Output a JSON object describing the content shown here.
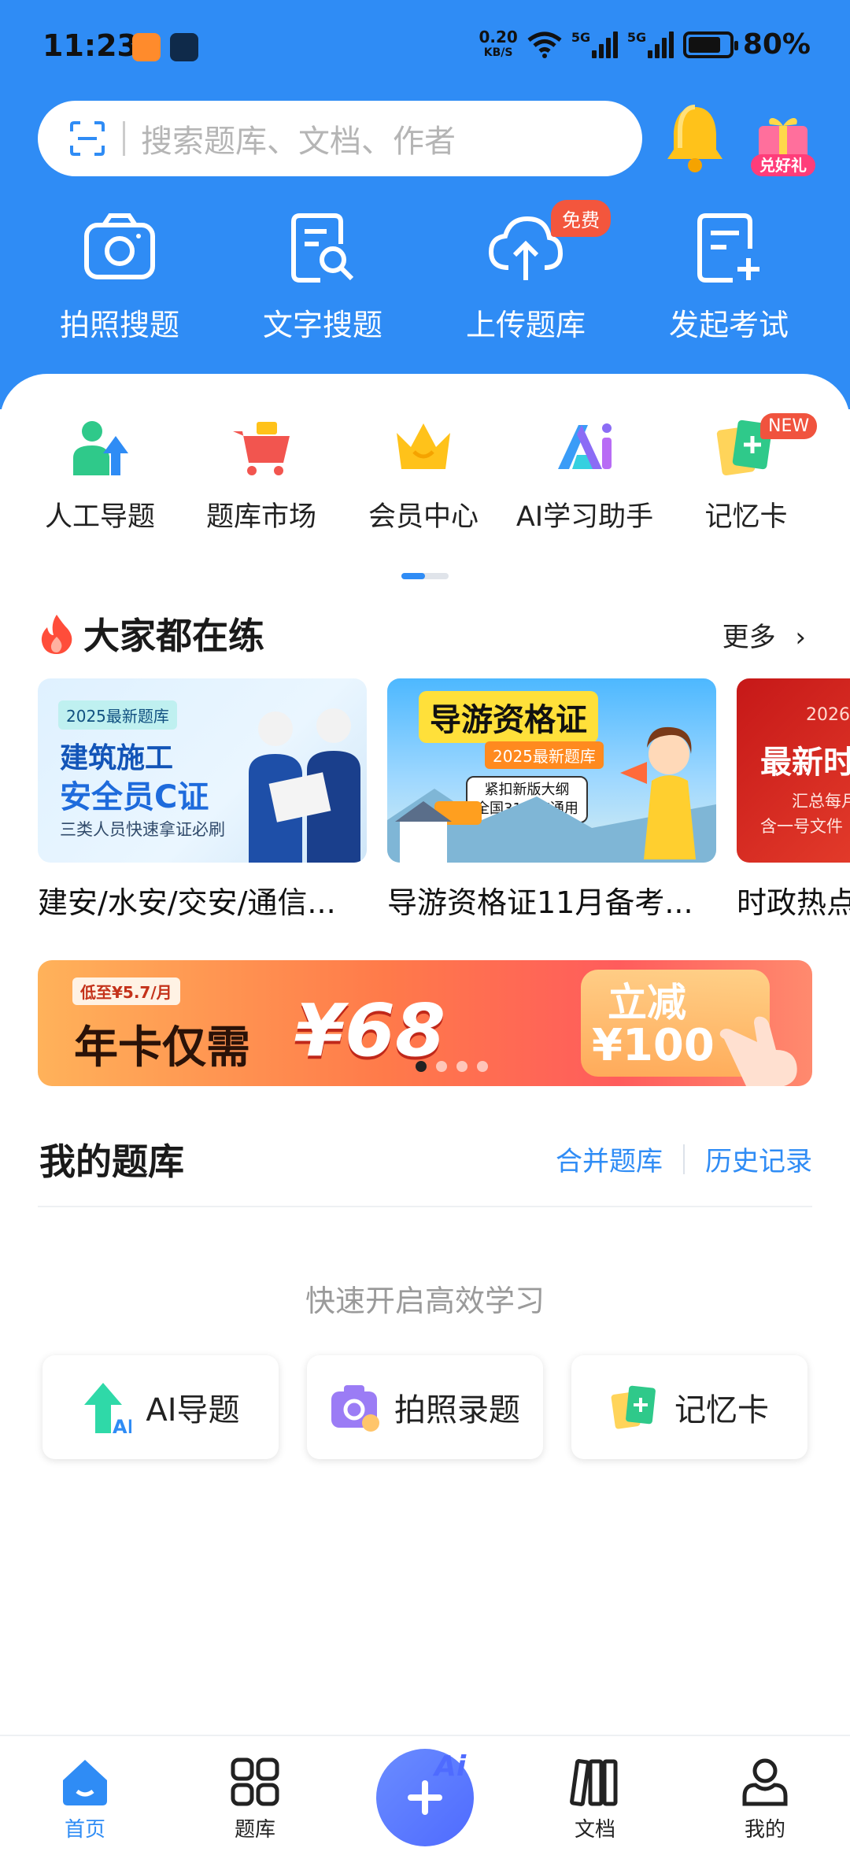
{
  "status_bar": {
    "time": "11:23",
    "net_speed_value": "0.20",
    "net_speed_unit": "KB/S",
    "signal_1": "5G",
    "signal_2": "5G",
    "battery": "80%"
  },
  "search": {
    "placeholder": "搜索题库、文档、作者"
  },
  "header": {
    "gift_label": "兑好礼"
  },
  "tools": [
    {
      "label": "拍照搜题",
      "icon": "camera-icon"
    },
    {
      "label": "文字搜题",
      "icon": "doc-search-icon"
    },
    {
      "label": "上传题库",
      "icon": "cloud-upload-icon",
      "badge": "免费"
    },
    {
      "label": "发起考试",
      "icon": "exam-add-icon"
    }
  ],
  "quick": [
    {
      "label": "人工导题",
      "icon": "person-upload-icon"
    },
    {
      "label": "题库市场",
      "icon": "cart-icon"
    },
    {
      "label": "会员中心",
      "icon": "crown-icon"
    },
    {
      "label": "AI学习助手",
      "icon": "ai-logo-icon"
    },
    {
      "label": "记忆卡",
      "icon": "flashcard-icon",
      "badge": "NEW"
    }
  ],
  "popular": {
    "title": "大家都在练",
    "more": "更多",
    "items": [
      {
        "tag": "2025最新题库",
        "line1": "建筑施工",
        "line2": "安全员C证",
        "line3": "三类人员快速拿证必刷",
        "title": "建安/水安/交安/通信..."
      },
      {
        "line1": "导游资格证",
        "tag": "2025最新题库",
        "line2": "紧扣新版大纲",
        "line3": "全国31省市通用",
        "title": "导游资格证11月备考..."
      },
      {
        "line1": "2026",
        "line2": "最新时",
        "line3": "汇总每月",
        "line4": "含一号文件",
        "title": "时政热点"
      }
    ]
  },
  "promo": {
    "low": "低至¥5.7/月",
    "main": "年卡仅需",
    "price": "¥68",
    "cut": "立减",
    "cut_amount": "¥100"
  },
  "my_library": {
    "title": "我的题库",
    "merge": "合并题库",
    "history": "历史记录",
    "hint": "快速开启高效学习",
    "buttons": [
      {
        "label": "AI导题",
        "icon": "ai-import-icon"
      },
      {
        "label": "拍照录题",
        "icon": "photo-entry-icon"
      },
      {
        "label": "记忆卡",
        "icon": "flashcard-icon"
      }
    ]
  },
  "tabbar": {
    "home": "首页",
    "library": "题库",
    "fab_ai": "Ai",
    "docs": "文档",
    "mine": "我的"
  },
  "colors": {
    "primary": "#2f8cf5",
    "badge_red": "#f3563d"
  }
}
